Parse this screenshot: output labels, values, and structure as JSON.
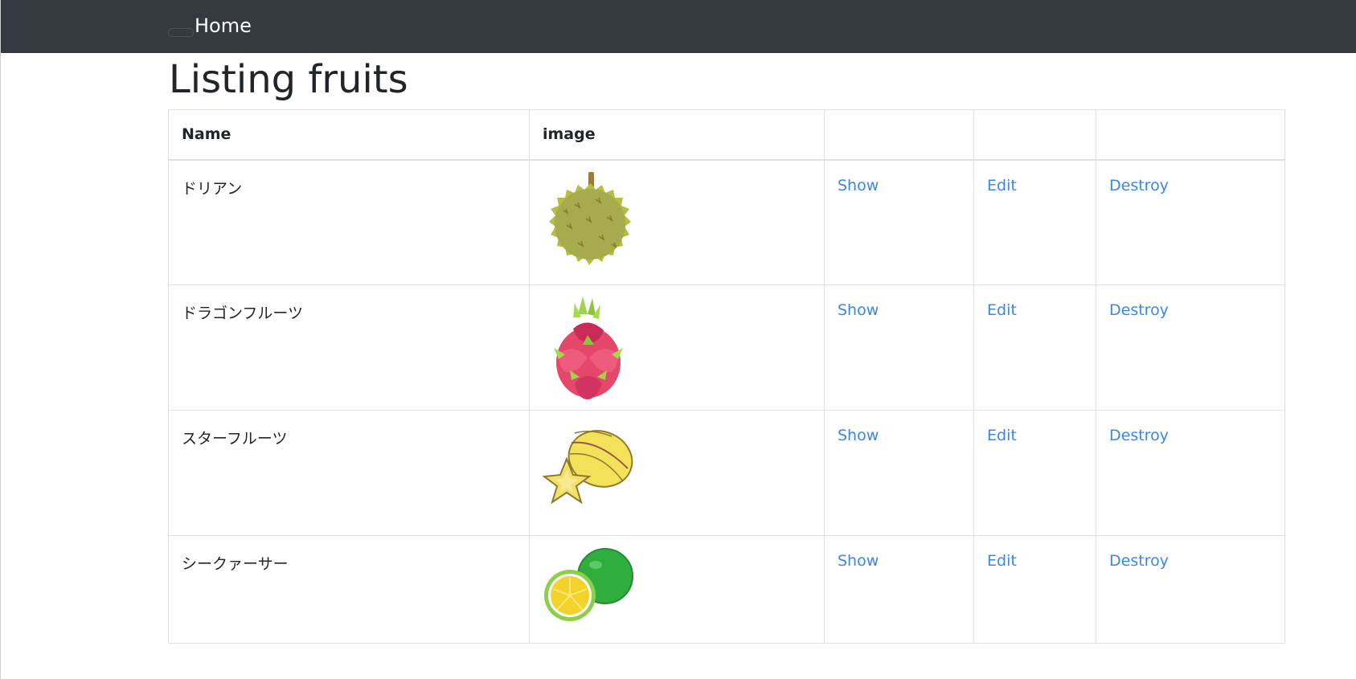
{
  "navbar": {
    "brand": "Home"
  },
  "page": {
    "title": "Listing fruits"
  },
  "table": {
    "headers": [
      "Name",
      "image",
      "",
      "",
      ""
    ],
    "rows": [
      {
        "name": "ドリアン",
        "image_icon": "durian-icon",
        "show": "Show",
        "edit": "Edit",
        "destroy": "Destroy"
      },
      {
        "name": "ドラゴンフルーツ",
        "image_icon": "dragon-fruit-icon",
        "show": "Show",
        "edit": "Edit",
        "destroy": "Destroy"
      },
      {
        "name": "スターフルーツ",
        "image_icon": "star-fruit-icon",
        "show": "Show",
        "edit": "Edit",
        "destroy": "Destroy"
      },
      {
        "name": "シークァーサー",
        "image_icon": "shikuwasa-icon",
        "show": "Show",
        "edit": "Edit",
        "destroy": "Destroy"
      }
    ]
  },
  "colors": {
    "navbar": "#343a40",
    "link": "#3b87e8",
    "border": "#dee2e6"
  }
}
